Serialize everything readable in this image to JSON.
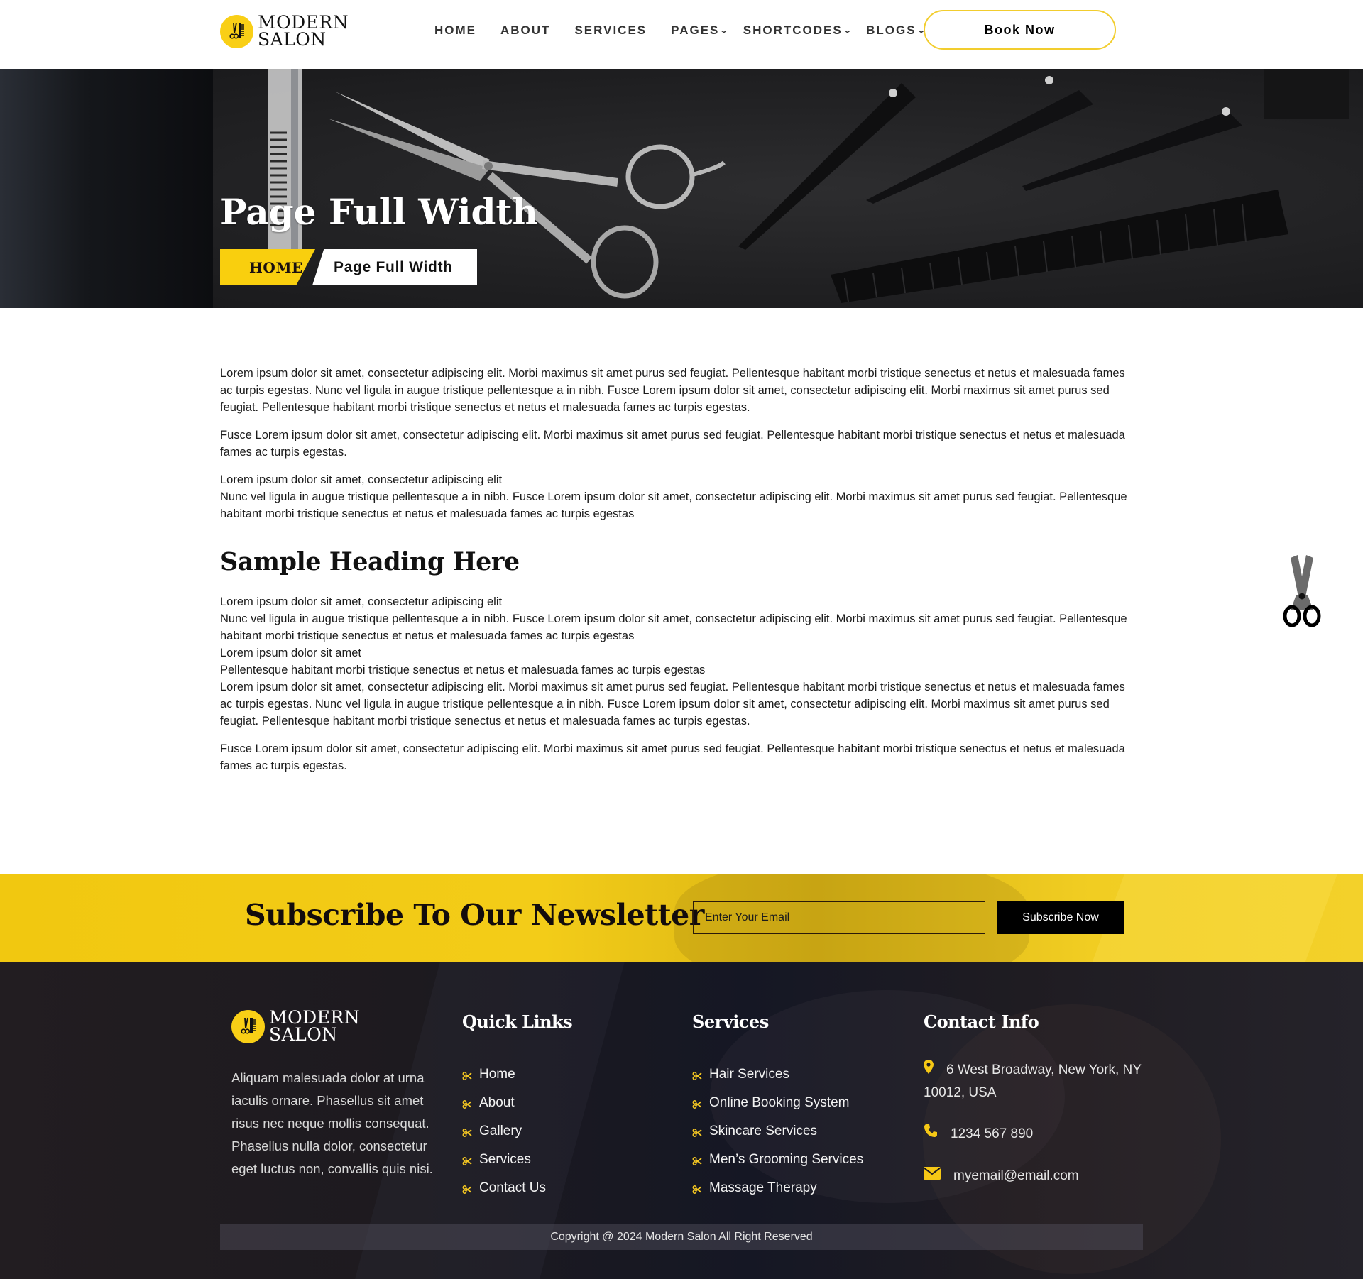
{
  "brand": {
    "name_line1": "MODERN",
    "name_line2": "SALON",
    "logo_icon": "scissors-comb-icon",
    "accent_color": "#f9cf16"
  },
  "nav": {
    "items": [
      {
        "label": "HOME",
        "has_dropdown": false
      },
      {
        "label": "ABOUT",
        "has_dropdown": false
      },
      {
        "label": "SERVICES",
        "has_dropdown": false
      },
      {
        "label": "PAGES",
        "has_dropdown": true
      },
      {
        "label": "SHORTCODES",
        "has_dropdown": true
      },
      {
        "label": "BLOGS",
        "has_dropdown": true
      }
    ],
    "cta_label": "Book Now"
  },
  "hero": {
    "title": "Page Full Width",
    "breadcrumb": {
      "home": "HOME",
      "current": "Page Full Width"
    }
  },
  "content": {
    "paragraphs_top": [
      "Lorem ipsum dolor sit amet, consectetur adipiscing elit. Morbi maximus sit amet purus sed feugiat. Pellentesque habitant morbi tristique senectus et netus et malesuada fames ac turpis egestas. Nunc vel ligula in augue tristique pellentesque a in nibh. Fusce Lorem ipsum dolor sit amet, consectetur adipiscing elit. Morbi maximus sit amet purus sed feugiat. Pellentesque habitant morbi tristique senectus et netus et malesuada fames ac turpis egestas.",
      "Fusce Lorem ipsum dolor sit amet, consectetur adipiscing elit. Morbi maximus sit amet purus sed feugiat. Pellentesque habitant morbi tristique senectus et netus et malesuada fames ac turpis egestas."
    ],
    "lines_block1": [
      "Lorem ipsum dolor sit amet, consectetur adipiscing elit",
      "Nunc vel ligula in augue tristique pellentesque a in nibh. Fusce Lorem ipsum dolor sit amet, consectetur adipiscing elit. Morbi maximus sit amet purus sed feugiat. Pellentesque habitant morbi tristique senectus et netus et malesuada fames ac turpis egestas"
    ],
    "heading": "Sample Heading Here",
    "lines_block2": [
      "Lorem ipsum dolor sit amet, consectetur adipiscing elit",
      "Nunc vel ligula in augue tristique pellentesque a in nibh. Fusce Lorem ipsum dolor sit amet, consectetur adipiscing elit. Morbi maximus sit amet purus sed feugiat. Pellentesque habitant morbi tristique senectus et netus et malesuada fames ac turpis egestas",
      "Lorem ipsum dolor sit amet",
      "Pellentesque habitant morbi tristique senectus et netus et malesuada fames ac turpis egestas",
      "Lorem ipsum dolor sit amet, consectetur adipiscing elit. Morbi maximus sit amet purus sed feugiat. Pellentesque habitant morbi tristique senectus et netus et malesuada fames ac turpis egestas. Nunc vel ligula in augue tristique pellentesque a in nibh. Fusce Lorem ipsum dolor sit amet, consectetur adipiscing elit. Morbi maximus sit amet purus sed feugiat. Pellentesque habitant morbi tristique senectus et netus et malesuada fames ac turpis egestas."
    ],
    "paragraph_bottom": "Fusce Lorem ipsum dolor sit amet, consectetur adipiscing elit. Morbi maximus sit amet purus sed feugiat. Pellentesque habitant morbi tristique senectus et netus et malesuada fames ac turpis egestas.",
    "floating_icon": "scissors-icon"
  },
  "newsletter": {
    "title": "Subscribe To Our Newsletter",
    "email_placeholder": "Enter Your Email",
    "email_value": "",
    "button_label": "Subscribe Now"
  },
  "footer": {
    "about": "Aliquam malesuada dolor at urna iaculis ornare. Phasellus sit amet risus nec neque mollis consequat. Phasellus nulla dolor, consectetur eget luctus non, convallis quis nisi.",
    "quick_links": {
      "title": "Quick Links",
      "items": [
        "Home",
        "About",
        "Gallery",
        "Services",
        "Contact Us"
      ]
    },
    "services": {
      "title": "Services",
      "items": [
        "Hair Services",
        "Online Booking System",
        "Skincare Services",
        "Men’s Grooming Services",
        "Massage Therapy"
      ]
    },
    "contact": {
      "title": "Contact Info",
      "address": "6 West Broadway, New York, NY 10012, USA",
      "phone": "1234 567 890",
      "email": "myemail@email.com",
      "icons": [
        "map-pin-icon",
        "phone-icon",
        "envelope-icon"
      ]
    },
    "copyright": "Copyright @ 2024 Modern Salon All Right Reserved"
  }
}
